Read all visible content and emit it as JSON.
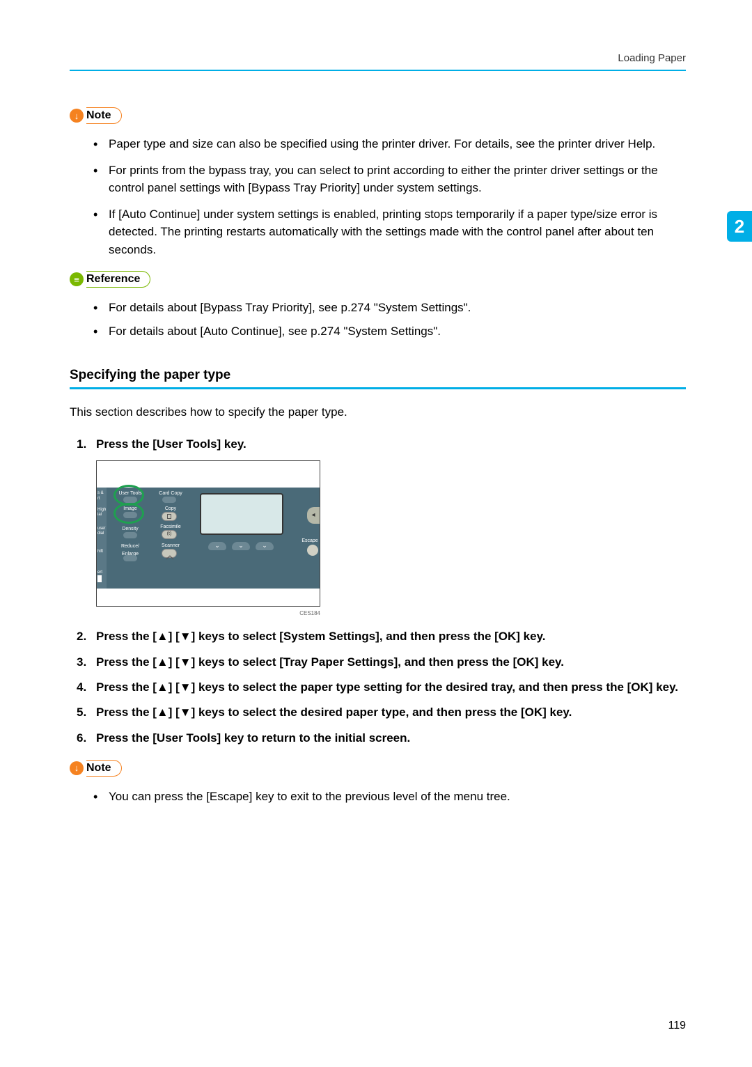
{
  "header": {
    "breadcrumb": "Loading Paper"
  },
  "sideTab": "2",
  "note1": {
    "label": "Note",
    "items": [
      "Paper type and size can also be specified using the printer driver. For details, see the printer driver Help.",
      "For prints from the bypass tray, you can select to print according to either the printer driver settings or the control panel settings with [Bypass Tray Priority] under system settings.",
      "If [Auto Continue] under system settings is enabled, printing stops temporarily if a paper type/size error is detected. The printing restarts automatically with the settings made with the control panel after about ten seconds."
    ]
  },
  "reference": {
    "label": "Reference",
    "items": [
      "For details about [Bypass Tray Priority], see p.274 \"System Settings\".",
      "For details about [Auto Continue], see p.274 \"System Settings\"."
    ]
  },
  "section": {
    "heading": "Specifying the paper type",
    "intro": "This section describes how to specify the paper type."
  },
  "steps": {
    "s1": "Press the [User Tools] key.",
    "s2": "Press the [▲] [▼] keys to select [System Settings], and then press the [OK] key.",
    "s3": "Press the [▲] [▼] keys to select [Tray Paper Settings], and then press the [OK] key.",
    "s4": "Press the [▲] [▼] keys to select the paper type setting for the desired tray, and then press the [OK] key.",
    "s5": "Press the [▲] [▼] keys to select the desired paper type, and then press the [OK] key.",
    "s6": "Press the [User Tools] key to return to the initial screen."
  },
  "panel": {
    "userTools": "User Tools",
    "image": "Image",
    "density": "Density",
    "reduceEnlarge": "Reduce/\nEnlarge",
    "cardCopy": "Card Copy",
    "copy": "Copy",
    "facsimile": "Facsimile",
    "scanner": "Scanner",
    "escape": "Escape",
    "leftLabels": [
      "s &",
      "rt",
      "High",
      "ial",
      "use/",
      "dial",
      "hift",
      "ert"
    ],
    "imageCode": "CES184"
  },
  "note2": {
    "label": "Note",
    "items": [
      "You can press the [Escape] key to exit to the previous level of the menu tree."
    ]
  },
  "pageNumber": "119"
}
